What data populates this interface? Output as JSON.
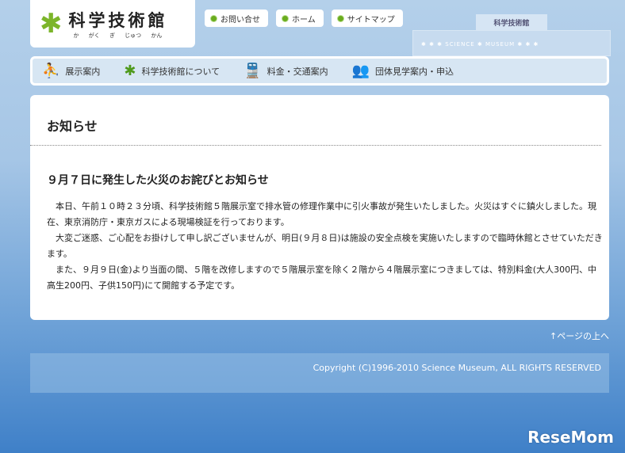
{
  "logo": {
    "title": "科学技術館",
    "ruby": "か がく ぎ じゅつ かん"
  },
  "toplinks": [
    "お問い合せ",
    "ホーム",
    "サイトマップ"
  ],
  "building": {
    "label": "科学技術館",
    "sign": "✱ ✱ ✱ SCIENCE ✱ MUSEUM ✱ ✱ ✱"
  },
  "nav": [
    {
      "label": "展示案内",
      "icon": "person-at-desk-icon",
      "glyph": "⛹"
    },
    {
      "label": "科学技術館について",
      "icon": "star-logo-icon",
      "glyph": "✱"
    },
    {
      "label": "料金・交通案内",
      "icon": "train-icon",
      "glyph": "🚆"
    },
    {
      "label": "団体見学案内・申込",
      "icon": "group-icon",
      "glyph": "👥"
    }
  ],
  "main": {
    "title": "お知らせ",
    "heading": "９月７日に発生した火災のお詫びとお知らせ",
    "paragraphs": [
      "本日、午前１０時２３分頃、科学技術館５階展示室で排水管の修理作業中に引火事故が発生いたしました。火災はすぐに鎮火しました。現在、東京消防庁・東京ガスによる現場検証を行っております。",
      "大変ご迷惑、ご心配をお掛けして申し訳ございませんが、明日(９月８日)は施設の安全点検を実施いたしますので臨時休館とさせていただきます。",
      "また、９月９日(金)より当面の間、５階を改修しますので５階展示室を除く２階から４階展示室につきましては、特別料金(大人300円、中高生200円、子供150円)にて開館する予定です。"
    ]
  },
  "totop": "↑ページの上へ",
  "footer": "Copyright (C)1996-2010 Science Museum, ALL RIGHTS RESERVED",
  "watermark": "ReseMom"
}
